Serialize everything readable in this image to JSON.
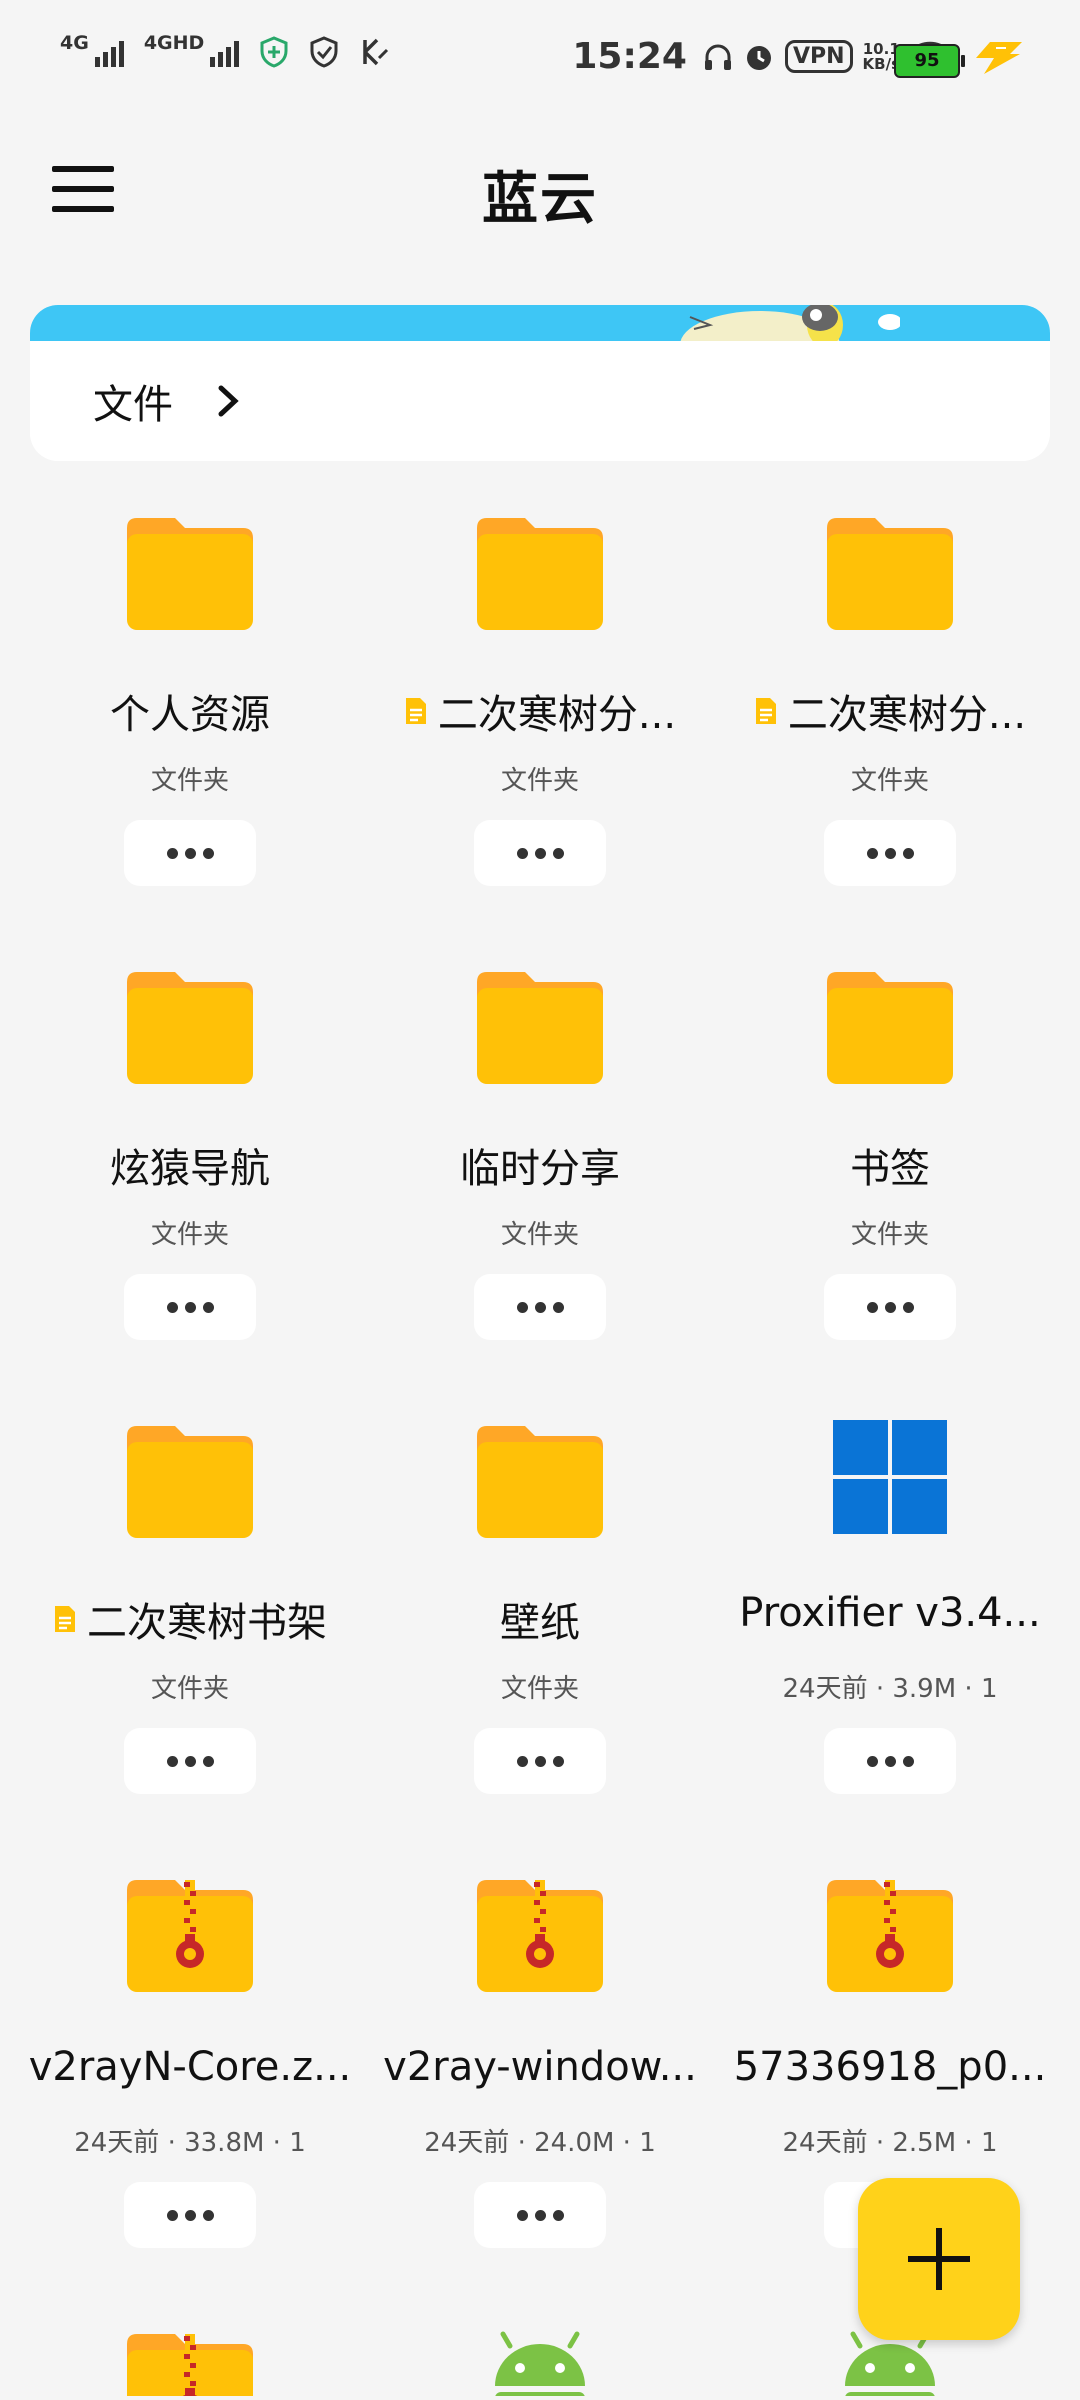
{
  "status_bar": {
    "network_1": "4G",
    "network_2": "4GHD",
    "time": "15:24",
    "vpn": "VPN",
    "speed_value": "10.1",
    "speed_unit": "KB/s",
    "battery": "95"
  },
  "app_bar": {
    "title": "蓝云"
  },
  "breadcrumb": {
    "label": "文件"
  },
  "items": [
    {
      "name": "个人资源",
      "meta": "文件夹",
      "type": "folder",
      "doc_badge": false
    },
    {
      "name": "二次寒树分...",
      "meta": "文件夹",
      "type": "folder",
      "doc_badge": true
    },
    {
      "name": "二次寒树分...",
      "meta": "文件夹",
      "type": "folder",
      "doc_badge": true
    },
    {
      "name": "炫猿导航",
      "meta": "文件夹",
      "type": "folder",
      "doc_badge": false
    },
    {
      "name": "临时分享",
      "meta": "文件夹",
      "type": "folder",
      "doc_badge": false
    },
    {
      "name": "书签",
      "meta": "文件夹",
      "type": "folder",
      "doc_badge": false
    },
    {
      "name": "二次寒树书架",
      "meta": "文件夹",
      "type": "folder",
      "doc_badge": true
    },
    {
      "name": "壁纸",
      "meta": "文件夹",
      "type": "folder",
      "doc_badge": false
    },
    {
      "name": "Proxifier v3.4...",
      "meta": "24天前 · 3.9M · 1",
      "type": "windows",
      "doc_badge": false
    },
    {
      "name": "v2rayN-Core.z...",
      "meta": "24天前 · 33.8M · 1",
      "type": "zip",
      "doc_badge": false
    },
    {
      "name": "v2ray-window...",
      "meta": "24天前 · 24.0M · 1",
      "type": "zip",
      "doc_badge": false
    },
    {
      "name": "57336918_p0...",
      "meta": "24天前 · 2.5M · 1",
      "type": "zip",
      "doc_badge": false
    }
  ],
  "partial_items": [
    {
      "type": "zip"
    },
    {
      "type": "android"
    },
    {
      "type": "android"
    }
  ],
  "colors": {
    "folder": "#ffc107",
    "folder_tab": "#ffa726",
    "accent_fab": "#ffd21a",
    "windows": "#0a74d6",
    "android": "#7cc245",
    "banner": "#3ec6f5"
  },
  "icons": {
    "menu": "hamburger-menu-icon",
    "chevron": "chevron-right-icon",
    "more": "more-horizontal-icon",
    "add": "plus-icon"
  }
}
